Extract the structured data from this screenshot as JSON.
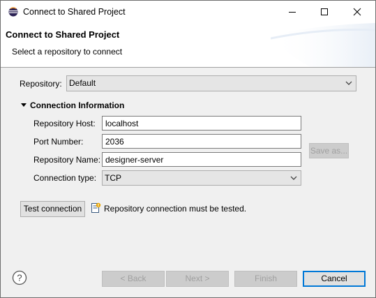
{
  "window": {
    "title": "Connect to Shared Project",
    "controls": [
      "minimize-icon",
      "maximize-icon",
      "close-icon"
    ]
  },
  "header": {
    "title": "Connect to Shared Project",
    "subtitle": "Select a repository to connect"
  },
  "repository": {
    "label": "Repository:",
    "selected": "Default"
  },
  "connection": {
    "section_title": "Connection Information",
    "expanded": true,
    "host_label": "Repository Host:",
    "host_value": "localhost",
    "port_label": "Port Number:",
    "port_value": "2036",
    "name_label": "Repository Name:",
    "name_value": "designer-server",
    "type_label": "Connection type:",
    "type_selected": "TCP",
    "save_as_label": "Save as..."
  },
  "test": {
    "button_label": "Test connection",
    "status_message": "Repository connection must be tested.",
    "status_icon": "info-document-icon"
  },
  "footer": {
    "help_icon": "help-icon",
    "back_label": "< Back",
    "next_label": "Next >",
    "finish_label": "Finish",
    "cancel_label": "Cancel"
  },
  "colors": {
    "dialog_bg": "#f0f0f0",
    "header_bg": "#ffffff",
    "default_button_border": "#0078d7",
    "disabled_text": "#a0a0a0"
  }
}
